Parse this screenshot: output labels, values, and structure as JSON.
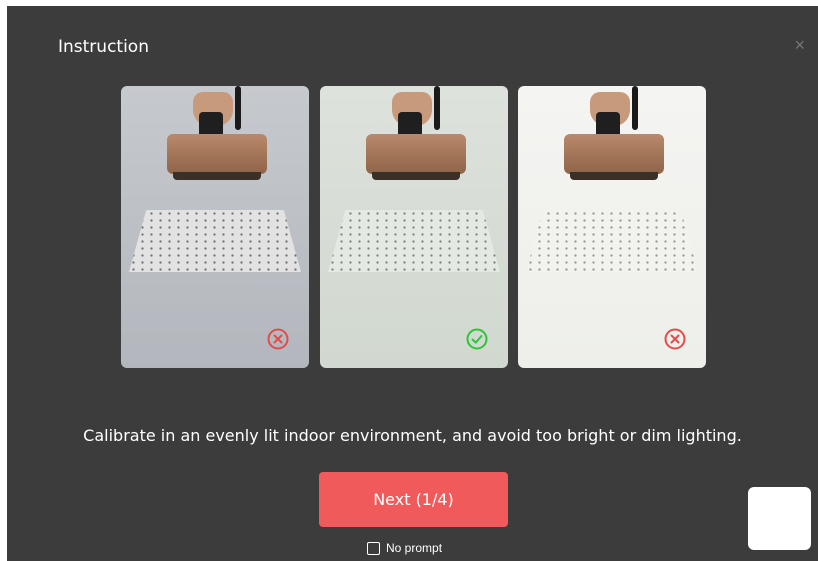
{
  "dialog": {
    "title": "Instruction",
    "close_icon": "×",
    "caption": "Calibrate in an evenly lit indoor environment, and avoid too bright or dim lighting.",
    "next_label": "Next (1/4)",
    "no_prompt_label": "No prompt"
  },
  "panels": [
    {
      "status": "error",
      "status_icon": "error-icon"
    },
    {
      "status": "ok",
      "status_icon": "check-icon"
    },
    {
      "status": "error",
      "status_icon": "error-icon"
    }
  ],
  "colors": {
    "accent": "#f05a5b",
    "error": "#e24c4c",
    "ok": "#2ec43a",
    "dialog_bg": "#3c3c3c"
  }
}
